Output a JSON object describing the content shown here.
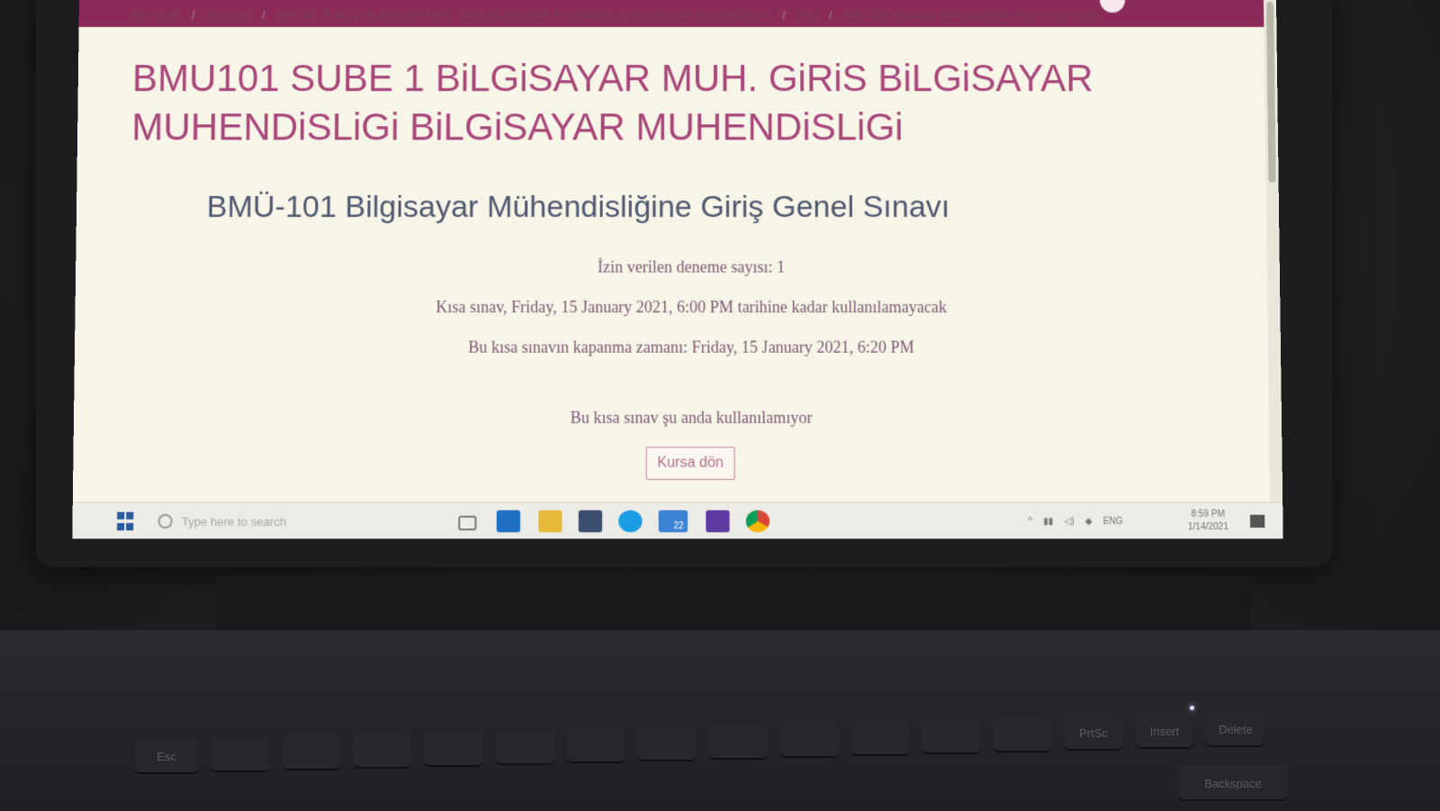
{
  "breadcrumb": {
    "items": [
      "Ana Sayfa",
      "Derslerim",
      "BMU101 SUBE 1 BiLGiSAYAR MUH. GiRiS BiLGiSAYAR MUHENDiSLiGi BiLGiSAYAR MUHENDiSLiGi",
      "Giriş",
      "BMÜ-101 Bilgisayar Mühendisliğine Giriş Genel Sınavı"
    ],
    "separator": "/"
  },
  "page": {
    "course_title": "BMU101 SUBE 1 BiLGiSAYAR MUH. GiRiS BiLGiSAYAR MUHENDiSLiGi BiLGiSAYAR MUHENDiSLiGi",
    "quiz_title": "BMÜ-101 Bilgisayar Mühendisliğine Giriş Genel Sınavı",
    "attempts_allowed": "İzin verilen deneme sayısı: 1",
    "opens_info": "Kısa sınav, Friday, 15 January 2021, 6:00 PM tarihine kadar kullanılamayacak",
    "closes_info": "Bu kısa sınavın kapanma zamanı: Friday, 15 January 2021, 6:20 PM",
    "unavailable_info": "Bu kısa sınav şu anda kullanılamıyor",
    "back_button": "Kursa dön"
  },
  "taskbar": {
    "search_placeholder": "Type here to search",
    "mail_badge": "22",
    "lang": "ENG",
    "time": "8:59 PM",
    "date": "1/14/2021"
  },
  "keyboard": {
    "keys": [
      "Esc",
      "PrtSc",
      "Insert",
      "Delete",
      "Backspace"
    ]
  },
  "colors": {
    "brand": "#8a2c57",
    "title": "#a8477a",
    "page_bg": "#f7f5e8"
  }
}
